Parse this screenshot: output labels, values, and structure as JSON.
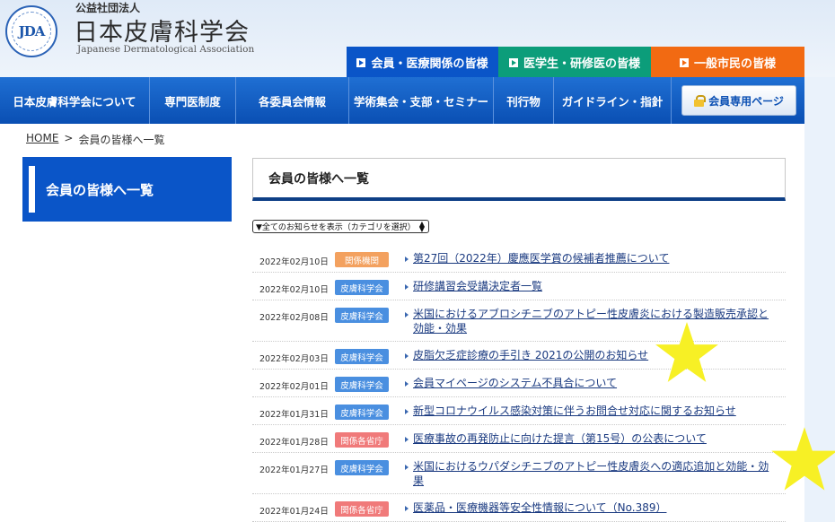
{
  "header": {
    "org_type": "公益社団法人",
    "org_name": "日本皮膚科学会",
    "org_name_en": "Japanese Dermatological Association",
    "logo_text": "JDA"
  },
  "audience_tabs": [
    {
      "label": "会員・医療関係の皆様",
      "color": "#0a55c8"
    },
    {
      "label": "医学生・研修医の皆様",
      "color": "#0c9d7a"
    },
    {
      "label": "一般市民の皆様",
      "color": "#f26a12"
    }
  ],
  "nav": {
    "items": [
      "日本皮膚科学会について",
      "専門医制度",
      "各委員会情報",
      "学術集会・支部・セミナー",
      "刊行物",
      "ガイドライン・指針"
    ],
    "member_button": "会員専用ページ"
  },
  "breadcrumb": {
    "home": "HOME",
    "separator": ">",
    "current": "会員の皆様へ一覧"
  },
  "sidebar": {
    "title": "会員の皆様へ一覧"
  },
  "panel": {
    "title": "会員の皆様へ一覧"
  },
  "category_select": {
    "selected": "▼全てのお知らせを表示（カテゴリを選択）"
  },
  "badge_colors": {
    "関係機関": "#f3a15f",
    "皮膚科学会": "#4a8fe0",
    "関係各省庁": "#f07a7a"
  },
  "news": [
    {
      "date": "2022年02月10日",
      "category": "関係機関",
      "title": "第27回（2022年）慶應医学賞の候補者推薦について"
    },
    {
      "date": "2022年02月10日",
      "category": "皮膚科学会",
      "title": "研修講習会受講決定者一覧"
    },
    {
      "date": "2022年02月08日",
      "category": "皮膚科学会",
      "title": "米国におけるアブロシチニブのアトピー性皮膚炎における製造販売承認と効能・効果"
    },
    {
      "date": "2022年02月03日",
      "category": "皮膚科学会",
      "title": "皮脂欠乏症診療の手引き 2021の公開のお知らせ"
    },
    {
      "date": "2022年02月01日",
      "category": "皮膚科学会",
      "title": "会員マイページのシステム不具合について"
    },
    {
      "date": "2022年01月31日",
      "category": "皮膚科学会",
      "title": "新型コロナウイルス感染対策に伴うお問合せ対応に関するお知らせ"
    },
    {
      "date": "2022年01月28日",
      "category": "関係各省庁",
      "title": "医療事故の再発防止に向けた提言（第15号）の公表について"
    },
    {
      "date": "2022年01月27日",
      "category": "皮膚科学会",
      "title": "米国におけるウパダシチニブのアトピー性皮膚炎への適応追加と効能・効果"
    },
    {
      "date": "2022年01月24日",
      "category": "関係各省庁",
      "title": "医薬品・医療機器等安全性情報について（No.389）"
    }
  ],
  "star_color": "#f7f025"
}
